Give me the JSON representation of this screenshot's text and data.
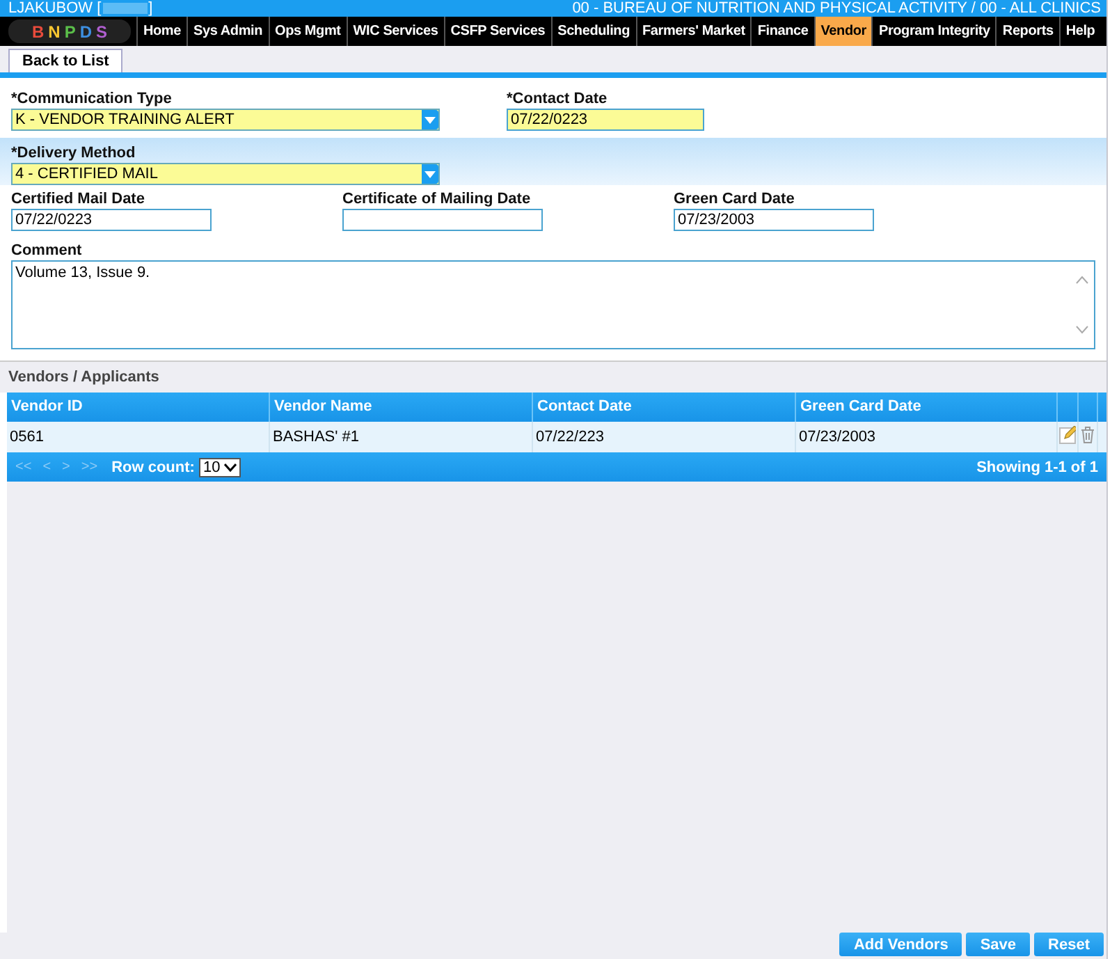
{
  "header": {
    "user": "LJAKUBOW [",
    "user_end": "]",
    "agency": "00 - BUREAU OF NUTRITION AND PHYSICAL ACTIVITY / 00 - ALL CLINICS"
  },
  "logo": {
    "letters": [
      "B",
      "N",
      "P",
      "D",
      "S"
    ]
  },
  "nav": [
    {
      "label": "Home",
      "selected": false
    },
    {
      "label": "Sys Admin",
      "selected": false
    },
    {
      "label": "Ops Mgmt",
      "selected": false
    },
    {
      "label": "WIC Services",
      "selected": false
    },
    {
      "label": "CSFP Services",
      "selected": false
    },
    {
      "label": "Scheduling",
      "selected": false
    },
    {
      "label": "Farmers' Market",
      "selected": false
    },
    {
      "label": "Finance",
      "selected": false
    },
    {
      "label": "Vendor",
      "selected": true
    },
    {
      "label": "Program Integrity",
      "selected": false
    },
    {
      "label": "Reports",
      "selected": false
    },
    {
      "label": "Help",
      "selected": false
    }
  ],
  "tabs": [
    {
      "label": "Back to List",
      "selected": true
    }
  ],
  "form": {
    "communication_type": {
      "label": "*Communication Type",
      "value": "K - VENDOR TRAINING ALERT"
    },
    "contact_date": {
      "label": "*Contact Date",
      "value": "07/22/0223"
    },
    "delivery_method": {
      "label": "*Delivery Method",
      "value": "4 - CERTIFIED MAIL"
    },
    "certified_mail_date": {
      "label": "Certified Mail Date",
      "value": "07/22/0223"
    },
    "certificate_of_mailing_date": {
      "label": "Certificate of Mailing Date"
    },
    "green_card_date": {
      "label": "Green Card Date",
      "value": "07/23/2003"
    },
    "comment": {
      "label": "Comment",
      "value": "Volume 13, Issue 9."
    }
  },
  "vendors": {
    "title": "Vendors / Applicants",
    "columns": [
      "Vendor ID",
      "Vendor Name",
      "Contact Date",
      "Green Card Date"
    ],
    "rows": [
      {
        "cells": [
          "0561",
          "BASHAS' #1",
          "07/22/223",
          "07/23/2003"
        ]
      }
    ],
    "pager": {
      "first": "<<",
      "prev": "<",
      "next": ">",
      "last": ">>",
      "row_count_label": "Row count:",
      "row_count": "10",
      "showing": "Showing 1-1 of 1"
    }
  },
  "buttons": [
    "Add Vendors",
    "Save",
    "Reset"
  ]
}
